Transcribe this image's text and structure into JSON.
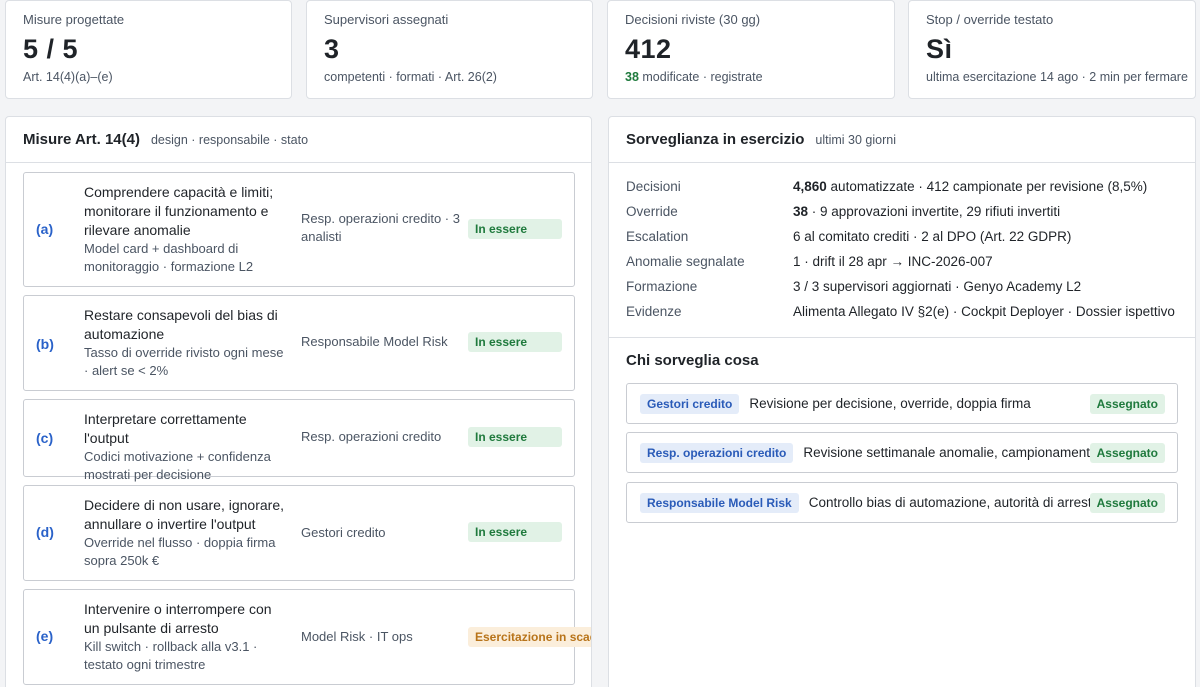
{
  "kpis": [
    {
      "label": "Misure progettate",
      "value": "5 / 5",
      "sub": "Art. 14(4)(a)–(e)"
    },
    {
      "label": "Supervisori assegnati",
      "value": "3",
      "sub": "competenti · formati · Art. 26(2)"
    },
    {
      "label": "Decisioni riviste (30 gg)",
      "value": "412",
      "sub_highlight": "38",
      "sub": " modificate · registrate"
    },
    {
      "label": "Stop / override testato",
      "value": "Sì",
      "sub": "ultima esercitazione 14 ago · 2 min per fermare"
    }
  ],
  "measures_panel": {
    "title": "Misure Art. 14(4)",
    "subtitle": "design · responsabile · stato",
    "rows": [
      {
        "letter": "(a)",
        "title": "Comprendere capacità e limiti; monitorare il funzionamento e rilevare anomalie",
        "design": "Model card + dashboard di monitoraggio · formazione L2",
        "owner": "Resp. operazioni credito · 3 analisti",
        "status": "In essere"
      },
      {
        "letter": "(b)",
        "title": "Restare consapevoli del bias di automazione",
        "design": "Tasso di override rivisto ogni mese · alert se < 2%",
        "owner": "Responsabile Model Risk",
        "status": "In essere"
      },
      {
        "letter": "(c)",
        "title": "Interpretare correttamente l'output",
        "design": "Codici motivazione + confidenza mostrati per decisione",
        "owner": "Resp. operazioni credito",
        "status": "In essere"
      },
      {
        "letter": "(d)",
        "title": "Decidere di non usare, ignorare, annullare o invertire l'output",
        "design": "Override nel flusso · doppia firma sopra 250k €",
        "owner": "Gestori credito",
        "status": "In essere"
      },
      {
        "letter": "(e)",
        "title": "Intervenire o interrompere con un pulsante di arresto",
        "design": "Kill switch · rollback alla v3.1 · testato ogni trimestre",
        "owner": "Model Risk · IT ops",
        "status": "Esercitazione in scadenza"
      }
    ]
  },
  "oversight_panel": {
    "title": "Sorveglianza in esercizio",
    "subtitle": "ultimi 30 giorni",
    "rows": [
      {
        "label": "Decisioni",
        "value_bold": "4,860",
        "value": " automatizzate · 412 campionate per revisione (8,5%)"
      },
      {
        "label": "Override",
        "value_bold": "38",
        "value": " · 9 approvazioni invertite, 29 rifiuti invertiti"
      },
      {
        "label": "Escalation",
        "value_bold": "",
        "value": "6 al comitato crediti · 2 al DPO (Art. 22 GDPR)"
      },
      {
        "label": "Anomalie segnalate",
        "value_bold": "",
        "value": "1 · drift il 28 apr → INC-2026-007"
      },
      {
        "label": "Formazione",
        "value_bold": "",
        "value": "3 / 3 supervisori aggiornati · Genyo Academy L2"
      },
      {
        "label": "Evidenze",
        "value_bold": "",
        "value": "Alimenta Allegato IV §2(e) · Cockpit Deployer · Dossier ispettivo"
      }
    ],
    "who_title": "Chi sorveglia cosa",
    "who": [
      {
        "role": "Gestori credito",
        "task": "Revisione per decisione, override, doppia firma",
        "status": "Assegnato"
      },
      {
        "role": "Resp. operazioni credito",
        "task": "Revisione settimanale anomalie, campionamento",
        "status": "Assegnato"
      },
      {
        "role": "Responsabile Model Risk",
        "task": "Controllo bias di automazione, autorità di arresto",
        "status": "Assegnato"
      }
    ]
  },
  "colors": {
    "accent_blue": "#2a62c9",
    "ok_green": "#1f7a3d",
    "warn_orange": "#b8741a"
  }
}
